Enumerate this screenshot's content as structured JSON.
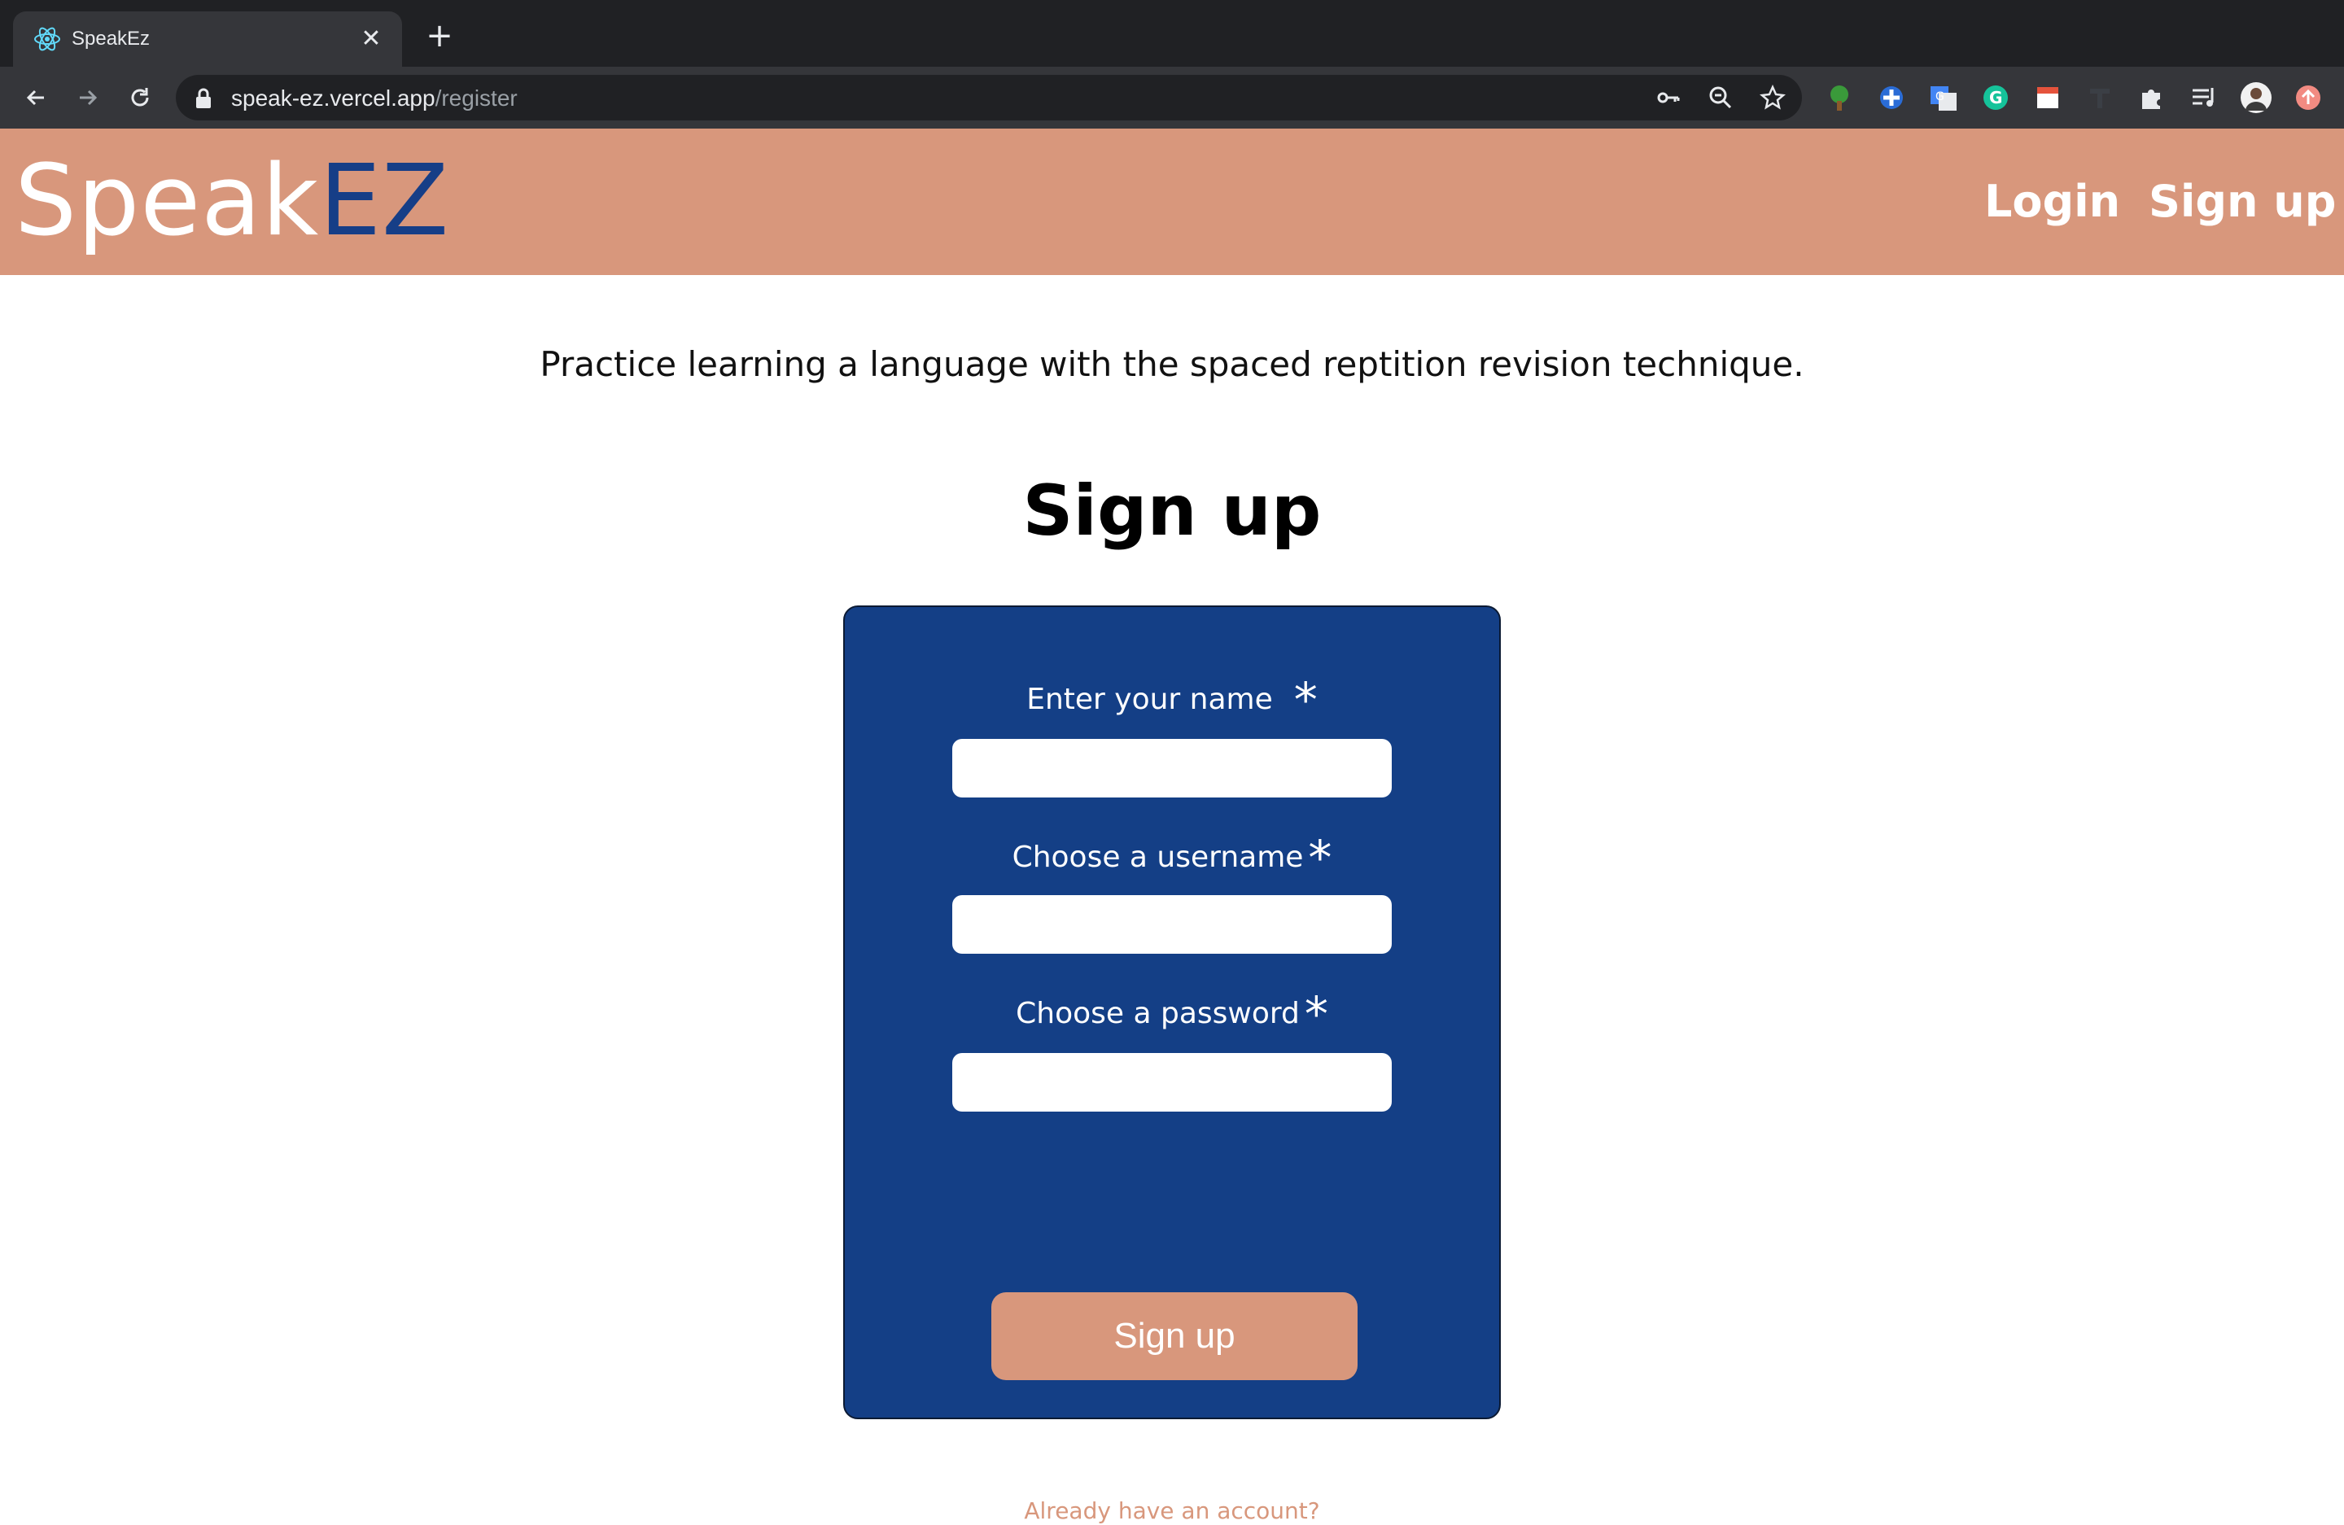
{
  "browser": {
    "tab": {
      "title": "SpeakEz",
      "favicon": "react-atom-icon",
      "close": "✕"
    },
    "new_tab": "+",
    "address": {
      "host": "speak-ez.vercel.app",
      "path": "/register"
    },
    "extensions": [
      "tree-extension-icon",
      "blue-cross-extension-icon",
      "google-translate-icon",
      "grammarly-icon",
      "calendar-extension-icon",
      "t-extension-icon",
      "puzzle-icon",
      "reading-list-icon",
      "profile-avatar",
      "update-icon"
    ]
  },
  "site": {
    "logo_speak": "Speak",
    "logo_ez": "EZ",
    "nav": {
      "login": "Login",
      "signup": "Sign up"
    },
    "tagline": "Practice learning a language with the spaced reptition revision technique.",
    "heading": "Sign up",
    "form": {
      "name_label": "Enter your name",
      "username_label": "Choose a username",
      "password_label": "Choose a password",
      "required_marker": "*",
      "name_value": "",
      "username_value": "",
      "password_value": "",
      "submit_label": "Sign up",
      "already_link": "Already have an account?"
    }
  },
  "colors": {
    "header_bg": "#d8977c",
    "brand_blue": "#163e87",
    "card_bg": "#143f86",
    "button_bg": "#d8977c"
  }
}
